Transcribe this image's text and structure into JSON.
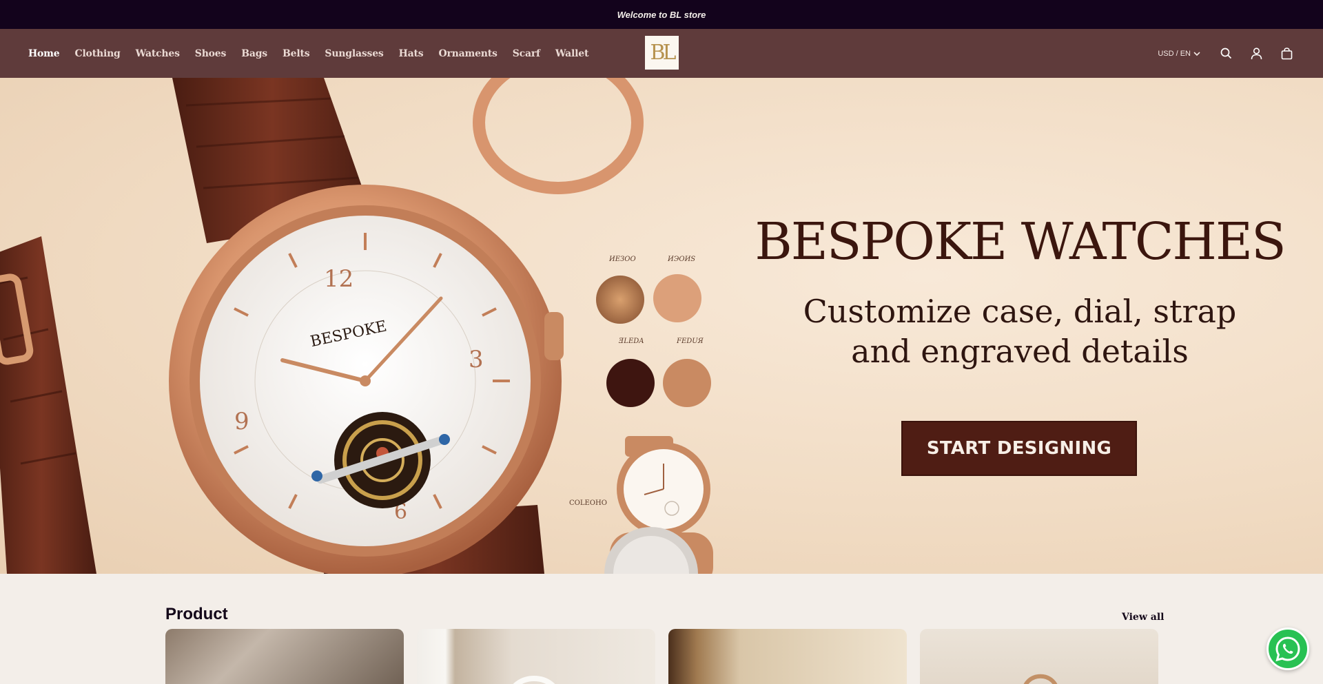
{
  "announcement": {
    "text": "Welcome to BL store"
  },
  "header": {
    "nav": [
      {
        "label": "Home",
        "active": true
      },
      {
        "label": "Clothing"
      },
      {
        "label": "Watches"
      },
      {
        "label": "Shoes"
      },
      {
        "label": "Bags"
      },
      {
        "label": "Belts"
      },
      {
        "label": "Sunglasses"
      },
      {
        "label": "Hats"
      },
      {
        "label": "Ornaments"
      },
      {
        "label": "Scarf"
      },
      {
        "label": "Wallet"
      }
    ],
    "logo_text": "BL",
    "locale": "USD / EN",
    "icons": [
      "search-icon",
      "account-icon",
      "cart-icon"
    ]
  },
  "hero": {
    "title": "BESPOKE WATCHES",
    "subtitle_line1": "Customize case, dial, strap",
    "subtitle_line2": "and engraved details",
    "cta_label": "START DESIGNING",
    "dial_brand": "BESPOKE",
    "swatch_labels": [
      "ИЕЗОО",
      "ИЭОИЅ",
      "ƎLEDA",
      "FEDUЯ",
      "COLEOHO"
    ]
  },
  "products": {
    "title": "Product",
    "view_all_label": "View all"
  },
  "colors": {
    "announcement_bg": "#13031c",
    "header_bg": "#5f3b3b",
    "cta_bg": "#4f1d14",
    "page_bg": "#f3eee9",
    "whatsapp": "#28c153"
  }
}
